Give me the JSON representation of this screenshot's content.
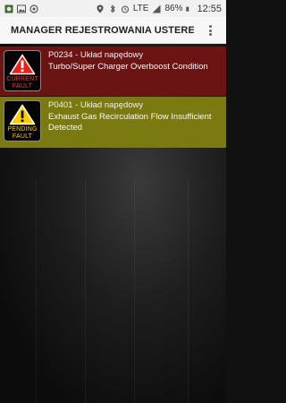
{
  "statusbar": {
    "battery_percent": "86%",
    "signal_label": "LTE",
    "time": "12:55",
    "icons": [
      "photo-notification-icon",
      "gallery-notification-icon",
      "obd-notification-icon",
      "location-icon",
      "bluetooth-icon",
      "alarm-icon",
      "wifi-icon",
      "lte-signal-icon",
      "battery-icon"
    ]
  },
  "appbar": {
    "title": "MANAGER REJESTROWANIA USTEREK - ...",
    "overflow_icon": "more-vert-icon"
  },
  "faults": [
    {
      "status": "current",
      "badge_line1": "CURRENT",
      "badge_line2": "FAULT",
      "code_line": "P0234 - Układ napędowy",
      "description": "Turbo/Super Charger Overboost Condition",
      "color": "#6b1414",
      "icon": "red-warning-triangle-icon"
    },
    {
      "status": "pending",
      "badge_line1": "PENDING",
      "badge_line2": "FAULT",
      "code_line": "P0401 - Układ napędowy",
      "description": "Exhaust Gas Recirculation Flow Insufficient Detected",
      "color": "#7a7a10",
      "icon": "yellow-warning-triangle-icon"
    }
  ]
}
